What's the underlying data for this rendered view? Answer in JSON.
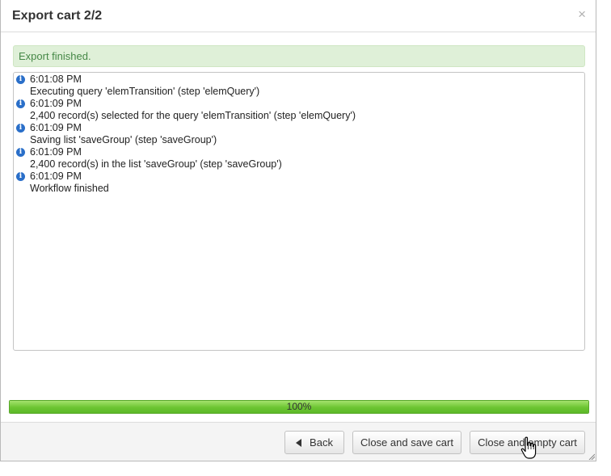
{
  "dialog": {
    "title": "Export cart 2/2",
    "close_label": "×"
  },
  "alert": {
    "message": "Export finished."
  },
  "log": [
    {
      "icon": "info-icon",
      "time": "6:01:08 PM",
      "message": "Executing query 'elemTransition' (step 'elemQuery')"
    },
    {
      "icon": "info-icon",
      "time": "6:01:09 PM",
      "message": "2,400 record(s) selected for the query 'elemTransition' (step 'elemQuery')"
    },
    {
      "icon": "info-icon",
      "time": "6:01:09 PM",
      "message": "Saving list 'saveGroup' (step 'saveGroup')"
    },
    {
      "icon": "info-icon",
      "time": "6:01:09 PM",
      "message": "2,400 record(s) in the list 'saveGroup' (step 'saveGroup')"
    },
    {
      "icon": "info-icon",
      "time": "6:01:09 PM",
      "message": "Workflow finished"
    }
  ],
  "progress": {
    "value": 100,
    "label": "100%"
  },
  "buttons": {
    "back_label": "Back",
    "save_label": "Close and save cart",
    "empty_label": "Close and empty cart"
  },
  "colors": {
    "success_bg": "#dff0d8",
    "success_text": "#468847",
    "progress_green": "#6cc532",
    "info_blue": "#2a6fc9"
  }
}
